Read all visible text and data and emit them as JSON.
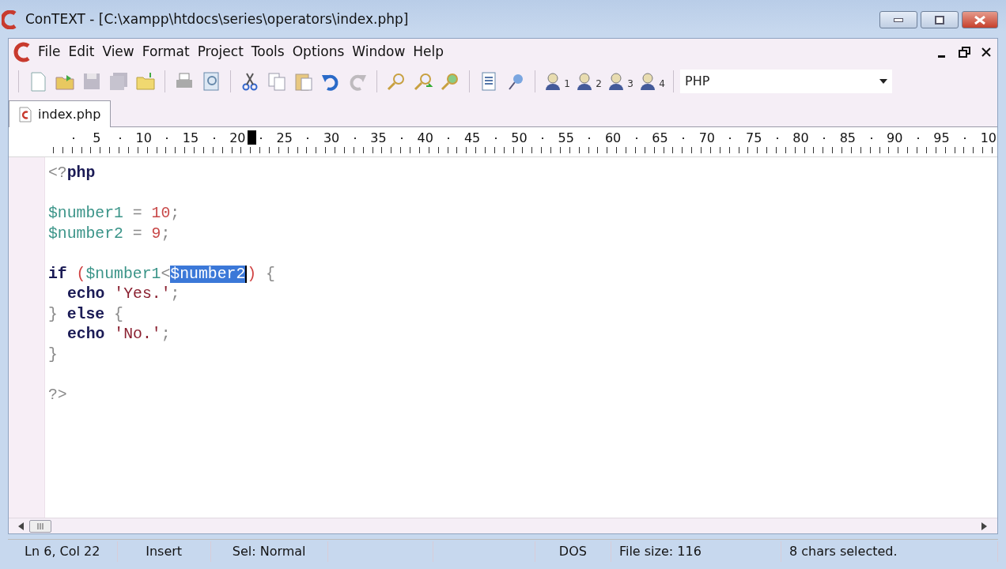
{
  "window": {
    "title": "ConTEXT - [C:\\xampp\\htdocs\\series\\operators\\index.php]"
  },
  "menu": [
    "File",
    "Edit",
    "View",
    "Format",
    "Project",
    "Tools",
    "Options",
    "Window",
    "Help"
  ],
  "toolbar": [
    [
      {
        "kind": "new",
        "disabled": false
      },
      {
        "kind": "open",
        "disabled": false
      },
      {
        "kind": "save",
        "disabled": true
      },
      {
        "kind": "save-all",
        "disabled": true
      },
      {
        "kind": "folder",
        "disabled": false
      }
    ],
    [
      {
        "kind": "print",
        "disabled": false
      },
      {
        "kind": "preview",
        "disabled": false
      }
    ],
    [
      {
        "kind": "cut",
        "disabled": false
      },
      {
        "kind": "copy",
        "disabled": false
      },
      {
        "kind": "paste",
        "disabled": false
      },
      {
        "kind": "undo",
        "disabled": false
      },
      {
        "kind": "redo",
        "disabled": true
      }
    ],
    [
      {
        "kind": "find",
        "disabled": false
      },
      {
        "kind": "find-next",
        "disabled": false
      },
      {
        "kind": "replace",
        "disabled": false
      }
    ],
    [
      {
        "kind": "list",
        "disabled": false
      },
      {
        "kind": "pin",
        "disabled": false
      }
    ],
    [
      {
        "kind": "user",
        "sub": "1",
        "disabled": false
      },
      {
        "kind": "user",
        "sub": "2",
        "disabled": false
      },
      {
        "kind": "user",
        "sub": "3",
        "disabled": false
      },
      {
        "kind": "user",
        "sub": "4",
        "disabled": false
      }
    ]
  ],
  "highlighter": {
    "value": "PHP"
  },
  "tabs": [
    {
      "label": "index.php",
      "selected": true
    }
  ],
  "ruler": [
    {
      "label": "5"
    },
    {
      "label": "10"
    },
    {
      "label": "15"
    },
    {
      "label": "20",
      "cursor_after": true
    },
    {
      "label": "25"
    },
    {
      "label": "30"
    },
    {
      "label": "35"
    },
    {
      "label": "40"
    },
    {
      "label": "45"
    },
    {
      "label": "50"
    },
    {
      "label": "55"
    },
    {
      "label": "60"
    },
    {
      "label": "65"
    },
    {
      "label": "70"
    },
    {
      "label": "75"
    },
    {
      "label": "80"
    },
    {
      "label": "85"
    },
    {
      "label": "90"
    },
    {
      "label": "95"
    },
    {
      "label": "10"
    }
  ],
  "code": [
    {
      "kind": "code",
      "tokens": [
        {
          "kind": "delim",
          "text": "<?"
        },
        {
          "kind": "keyword",
          "text": "php"
        }
      ]
    },
    {
      "kind": "blank"
    },
    {
      "kind": "code",
      "tokens": [
        {
          "kind": "variable",
          "text": "$number1"
        },
        {
          "kind": "op",
          "text": " = "
        },
        {
          "kind": "number",
          "text": "10"
        },
        {
          "kind": "op",
          "text": ";"
        }
      ]
    },
    {
      "kind": "code",
      "tokens": [
        {
          "kind": "variable",
          "text": "$number2"
        },
        {
          "kind": "op",
          "text": " = "
        },
        {
          "kind": "number",
          "text": "9"
        },
        {
          "kind": "op",
          "text": ";"
        }
      ]
    },
    {
      "kind": "blank"
    },
    {
      "kind": "code",
      "tokens": [
        {
          "kind": "keyword",
          "text": "if"
        },
        {
          "kind": "paren",
          "text": " ("
        },
        {
          "kind": "variable",
          "text": "$number1"
        },
        {
          "kind": "op",
          "text": "<"
        },
        {
          "kind": "variable",
          "text": "$number2",
          "selected": true
        },
        {
          "kind": "paren",
          "text": ")"
        },
        {
          "kind": "op",
          "text": " {"
        }
      ]
    },
    {
      "kind": "code",
      "indent": true,
      "tokens": [
        {
          "kind": "keyword",
          "text": "echo"
        },
        {
          "kind": "string",
          "text": " 'Yes.'"
        },
        {
          "kind": "op",
          "text": ";"
        }
      ]
    },
    {
      "kind": "code",
      "tokens": [
        {
          "kind": "op",
          "text": "} "
        },
        {
          "kind": "keyword",
          "text": "else"
        },
        {
          "kind": "op",
          "text": " {"
        }
      ]
    },
    {
      "kind": "code",
      "indent": true,
      "tokens": [
        {
          "kind": "keyword",
          "text": "echo"
        },
        {
          "kind": "string",
          "text": " 'No.'"
        },
        {
          "kind": "op",
          "text": ";"
        }
      ]
    },
    {
      "kind": "code",
      "tokens": [
        {
          "kind": "op",
          "text": "}"
        }
      ]
    },
    {
      "kind": "blank"
    },
    {
      "kind": "code",
      "tokens": [
        {
          "kind": "delim",
          "text": "?>"
        }
      ]
    }
  ],
  "status_bar": [
    {
      "kind": "text",
      "text": "Ln 6, Col 22"
    },
    {
      "kind": "text",
      "text": "Insert"
    },
    {
      "kind": "text",
      "text": "Sel: Normal"
    },
    {
      "kind": "blank"
    },
    {
      "kind": "blank"
    },
    {
      "kind": "text",
      "text": "DOS"
    },
    {
      "kind": "text",
      "text": "File size: 116"
    },
    {
      "kind": "text",
      "text": "8 chars selected."
    }
  ]
}
